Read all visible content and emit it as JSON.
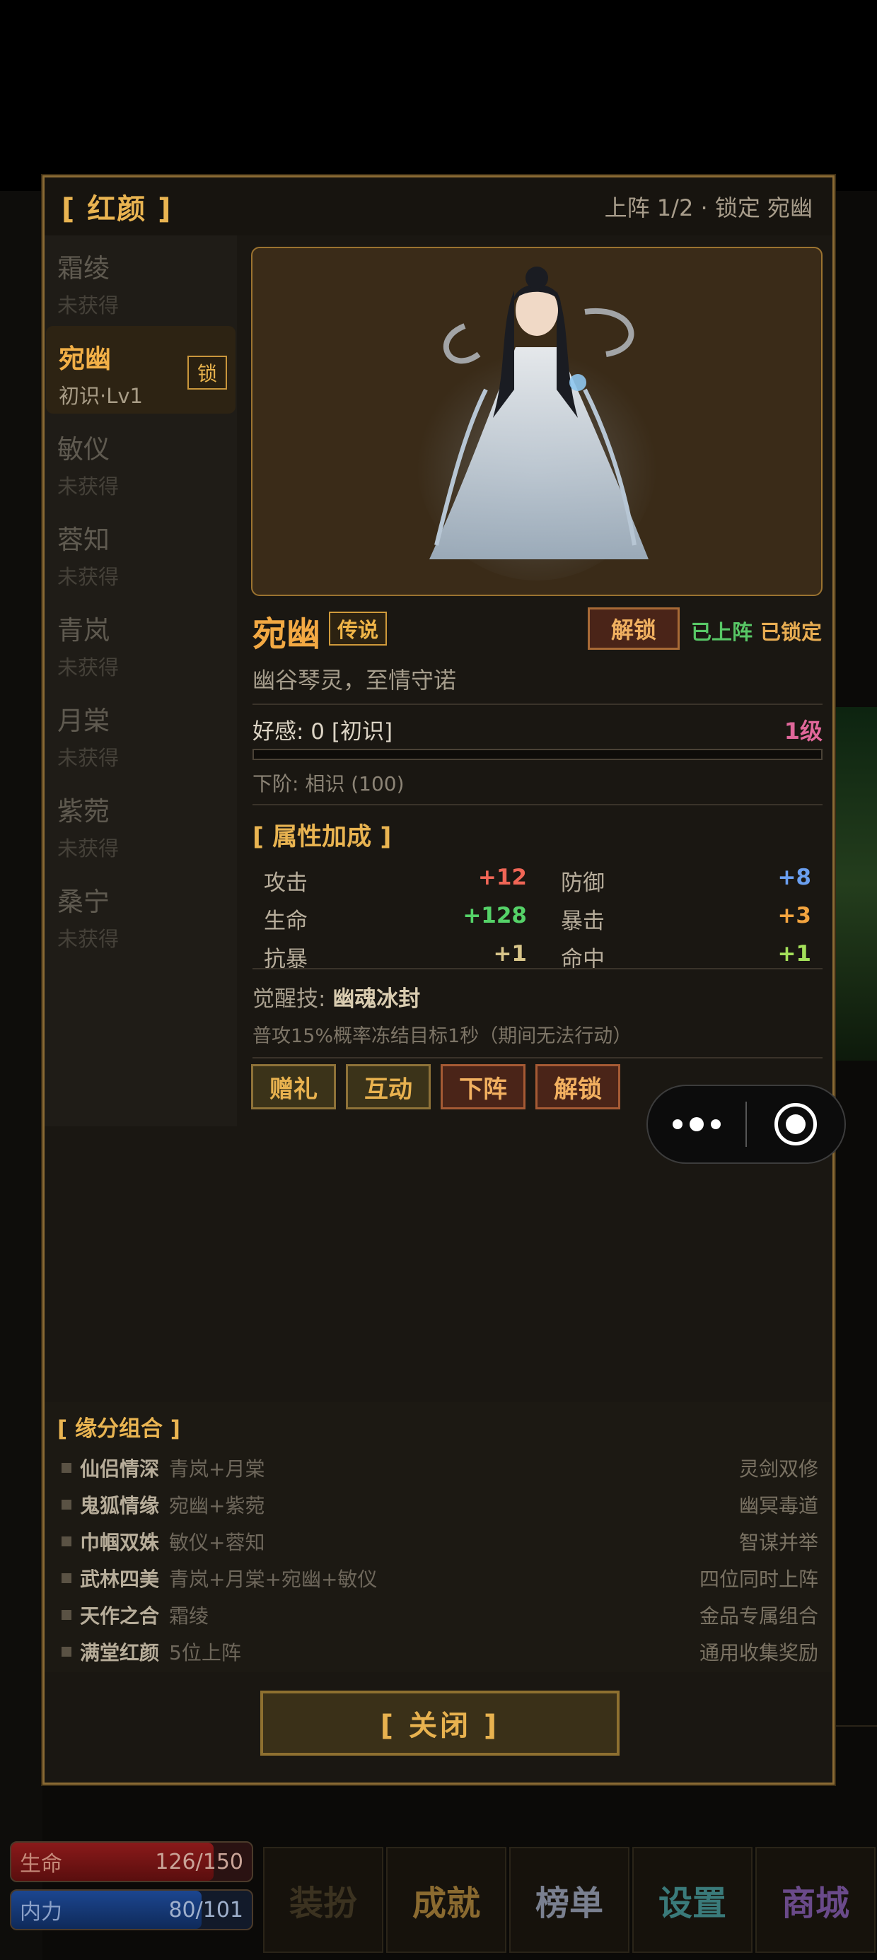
{
  "modal": {
    "title": "[ 红颜 ]",
    "status": "上阵 1/2 · 锁定 宛幽",
    "close_label": "[ 关闭 ]"
  },
  "list": [
    {
      "name": "霜绫",
      "sub": "未获得"
    },
    {
      "name": "宛幽",
      "sub": "初识·Lv1",
      "badge": "锁"
    },
    {
      "name": "敏仪",
      "sub": "未获得"
    },
    {
      "name": "蓉知",
      "sub": "未获得"
    },
    {
      "name": "青岚",
      "sub": "未获得"
    },
    {
      "name": "月棠",
      "sub": "未获得"
    },
    {
      "name": "紫菀",
      "sub": "未获得"
    },
    {
      "name": "桑宁",
      "sub": "未获得"
    }
  ],
  "detail": {
    "name": "宛幽",
    "rarity": "传说",
    "unlock_label": "解锁",
    "tag_deployed": "已上阵",
    "tag_locked": "已锁定",
    "description": "幽谷琴灵，至情守诺",
    "favor": "好感: 0 [初识]",
    "level": "1级",
    "favor_progress": 0,
    "next_stage": "下阶: 相识 (100)",
    "attr_title": "[ 属性加成 ]",
    "attrs": [
      {
        "label": "攻击",
        "value": "+12",
        "color": "#f06656"
      },
      {
        "label": "防御",
        "value": "+8",
        "color": "#6a9ff0"
      },
      {
        "label": "生命",
        "value": "+128",
        "color": "#55d268"
      },
      {
        "label": "暴击",
        "value": "+3",
        "color": "#f3a43f"
      },
      {
        "label": "抗暴",
        "value": "+1",
        "color": "#d8c58a"
      },
      {
        "label": "命中",
        "value": "+1",
        "color": "#a4e05a"
      }
    ],
    "skill_prefix": "觉醒技: ",
    "skill_name": "幽魂冰封",
    "skill_desc": "普攻15%概率冻结目标1秒（期间无法行动）",
    "buttons": [
      "赠礼",
      "互动",
      "下阵",
      "解锁"
    ]
  },
  "combos": {
    "title": "[ 缘分组合 ]",
    "items": [
      {
        "name": "仙侣情深",
        "members": "青岚+月棠",
        "desc": "灵剑双修"
      },
      {
        "name": "鬼狐情缘",
        "members": "宛幽+紫菀",
        "desc": "幽冥毒道"
      },
      {
        "name": "巾帼双姝",
        "members": "敏仪+蓉知",
        "desc": "智谋并举"
      },
      {
        "name": "武林四美",
        "members": "青岚+月棠+宛幽+敏仪",
        "desc": "四位同时上阵"
      },
      {
        "name": "天作之合",
        "members": "霜绫",
        "desc": "金品专属组合"
      },
      {
        "name": "满堂红颜",
        "members": "5位上阵",
        "desc": "通用收集奖励"
      }
    ]
  },
  "background": {
    "hp_label": "生命",
    "hp_value": "126/150",
    "mp_label": "内力",
    "mp_value": "80/101",
    "tiles": [
      "装扮",
      "成就",
      "榜单",
      "设置",
      "商城"
    ]
  },
  "capsule": {
    "more_icon": "more-dots-icon",
    "close_icon": "target-icon"
  }
}
